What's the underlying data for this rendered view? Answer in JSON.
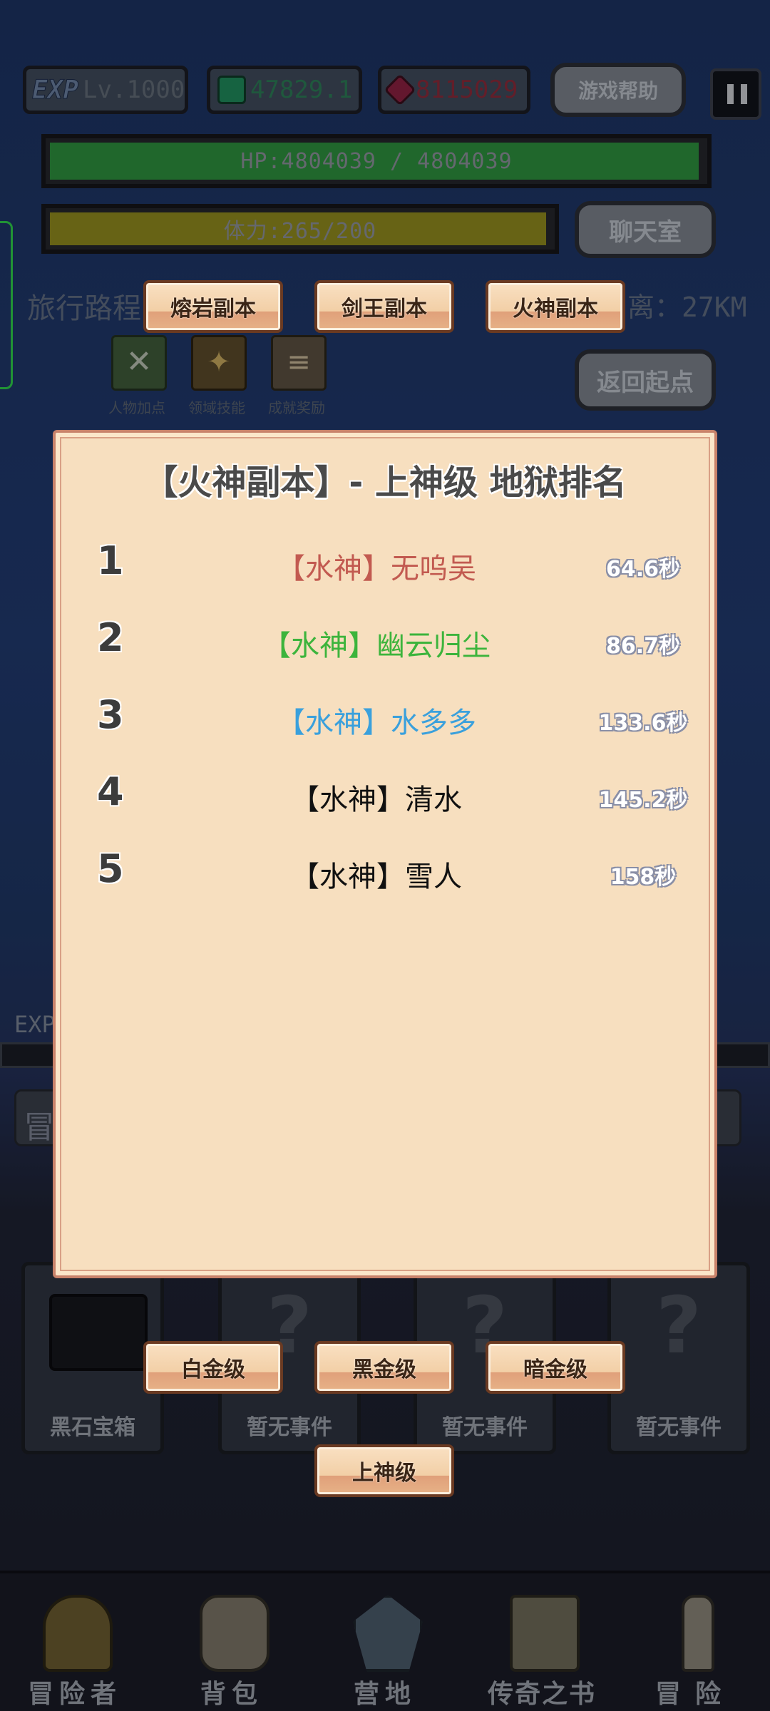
{
  "hud": {
    "exp_tag": "EXP",
    "level": "Lv.1000",
    "green_currency": "47829.1",
    "red_currency": "8115029",
    "help_button": "游戏帮助",
    "hp": "HP:4804039 / 4804039",
    "stamina": "体力:265/200",
    "chat_button": "聊天室",
    "travel_label": "旅行路程",
    "distance": "离：27KM",
    "return_button": "返回起点"
  },
  "skill_icons": [
    {
      "label": "人物加点",
      "icon": "crossed-swords-icon"
    },
    {
      "label": "领域技能",
      "icon": "skill-icon"
    },
    {
      "label": "成就奖励",
      "icon": "scroll-icon"
    }
  ],
  "dungeon_tabs": [
    "熔岩副本",
    "剑王副本",
    "火神副本"
  ],
  "ranking": {
    "title": "【火神副本】- 上神级 地狱排名",
    "entries": [
      {
        "rank": "1",
        "name": "【水神】无呜吴",
        "time": "64.6秒",
        "color": "#c25a50"
      },
      {
        "rank": "2",
        "name": "【水神】幽云归尘",
        "time": "86.7秒",
        "color": "#3cb43c"
      },
      {
        "rank": "3",
        "name": "【水神】水多多",
        "time": "133.6秒",
        "color": "#3aa0dc"
      },
      {
        "rank": "4",
        "name": "【水神】清水",
        "time": "145.2秒",
        "color": "#111111"
      },
      {
        "rank": "5",
        "name": "【水神】雪人",
        "time": "158秒",
        "color": "#111111"
      }
    ]
  },
  "tier_tabs": [
    "白金级",
    "黑金级",
    "暗金级",
    "上神级"
  ],
  "events": [
    "黑石宝箱",
    "暂无事件",
    "暂无事件",
    "暂无事件"
  ],
  "background_labels": {
    "exp": "EXP",
    "adventure": "冒"
  },
  "nav": [
    {
      "label": "冒险者",
      "icon": "helmet-icon"
    },
    {
      "label": "背包",
      "icon": "backpack-icon"
    },
    {
      "label": "营地",
      "icon": "camp-icon"
    },
    {
      "label": "传奇之书",
      "icon": "book-icon"
    },
    {
      "label": "冒险",
      "icon": "sword-icon"
    }
  ]
}
